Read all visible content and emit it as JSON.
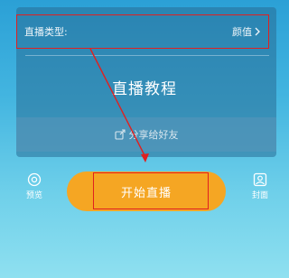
{
  "settings": {
    "live_type_label": "直播类型:",
    "live_type_value": "颜值"
  },
  "main": {
    "title": "直播教程",
    "share_label": "分享给好友"
  },
  "actions": {
    "preview_label": "预览",
    "start_label": "开始直播",
    "cover_label": "封面"
  },
  "icons": {
    "chevron": "chevron-right-icon",
    "share": "share-icon",
    "preview": "preview-icon",
    "cover": "cover-icon"
  },
  "colors": {
    "accent": "#f5a623",
    "highlight": "#e02020"
  }
}
